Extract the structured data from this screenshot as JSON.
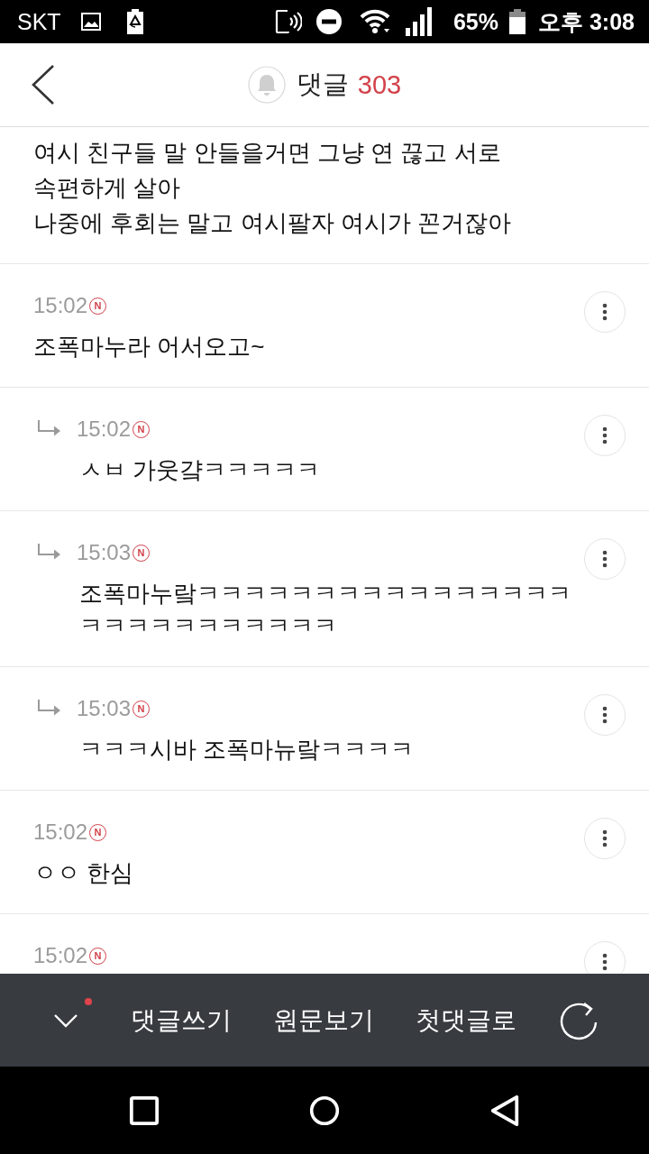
{
  "status_bar": {
    "carrier": "SKT",
    "battery": "65%",
    "time": "오후 3:08"
  },
  "header": {
    "title": "댓글",
    "count": "303"
  },
  "comments": [
    {
      "reply": false,
      "text": "여시 친구들 말 안들을거면 그냥 연 끊고 서로\n속편하게 살아\n나중에 후회는 말고 여시팔자 여시가 꼰거잖아"
    },
    {
      "reply": false,
      "time": "15:02",
      "badge": "N",
      "text": "조폭마누라 어서오고~"
    },
    {
      "reply": true,
      "time": "15:02",
      "badge": "N",
      "text": "ㅅㅂ 가웃걐ㅋㅋㅋㅋㅋ"
    },
    {
      "reply": true,
      "time": "15:03",
      "badge": "N",
      "text": "조폭마누랔ㅋㅋㅋㅋㅋㅋㅋㅋㅋㅋㅋㅋㅋㅋㅋㅋㅋㅋㅋㅋㅋㅋㅋㅋㅋㅋㅋ"
    },
    {
      "reply": true,
      "time": "15:03",
      "badge": "N",
      "text": "ㅋㅋㅋ시바 조폭마뉴랔ㅋㅋㅋㅋ"
    },
    {
      "reply": false,
      "time": "15:02",
      "badge": "N",
      "text": "ㅇㅇ 한심"
    },
    {
      "reply": false,
      "time": "15:02",
      "badge": "N"
    }
  ],
  "toolbar": {
    "notification": true,
    "actions": [
      "댓글쓰기",
      "원문보기",
      "첫댓글로"
    ]
  }
}
